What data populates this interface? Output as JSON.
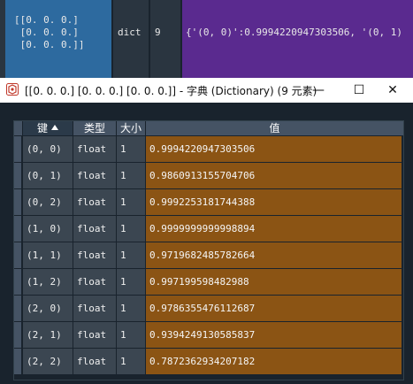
{
  "variable_row": {
    "value_lines": [
      "[[0. 0. 0.]",
      " [0. 0. 0.]",
      " [0. 0. 0.]]"
    ],
    "type": "dict",
    "size": "9",
    "value_preview": "{'(0, 0)':0.9994220947303506, '(0, 1)"
  },
  "dialog": {
    "title": "[[0. 0. 0.] [0. 0. 0.] [0. 0. 0.]] - 字典 (Dictionary) (9 元素)",
    "minimize_glyph": "—",
    "maximize_glyph": "☐",
    "close_glyph": "✕",
    "headers": {
      "key": "键",
      "type": "类型",
      "size": "大小",
      "value": "值"
    },
    "sort": {
      "column": "key",
      "direction": "ascending"
    },
    "rows": [
      {
        "key": "(0, 0)",
        "type": "float",
        "size": "1",
        "value": "0.9994220947303506"
      },
      {
        "key": "(0, 1)",
        "type": "float",
        "size": "1",
        "value": "0.9860913155704706"
      },
      {
        "key": "(0, 2)",
        "type": "float",
        "size": "1",
        "value": "0.9992253181744388"
      },
      {
        "key": "(1, 0)",
        "type": "float",
        "size": "1",
        "value": "0.9999999999998894"
      },
      {
        "key": "(1, 1)",
        "type": "float",
        "size": "1",
        "value": "0.9719682485782664"
      },
      {
        "key": "(1, 2)",
        "type": "float",
        "size": "1",
        "value": "0.997199598482988"
      },
      {
        "key": "(2, 0)",
        "type": "float",
        "size": "1",
        "value": "0.9786355476112687"
      },
      {
        "key": "(2, 1)",
        "type": "float",
        "size": "1",
        "value": "0.9394249130585837"
      },
      {
        "key": "(2, 2)",
        "type": "float",
        "size": "1",
        "value": "0.7872362934207182"
      }
    ]
  },
  "colors": {
    "background": "#19232d",
    "header": "#455364",
    "gray_cell": "#3b4651",
    "value_cell": "#8b5414",
    "selected_variable": "#2d6a9f",
    "value_preview_bg": "#5a2a8f"
  }
}
